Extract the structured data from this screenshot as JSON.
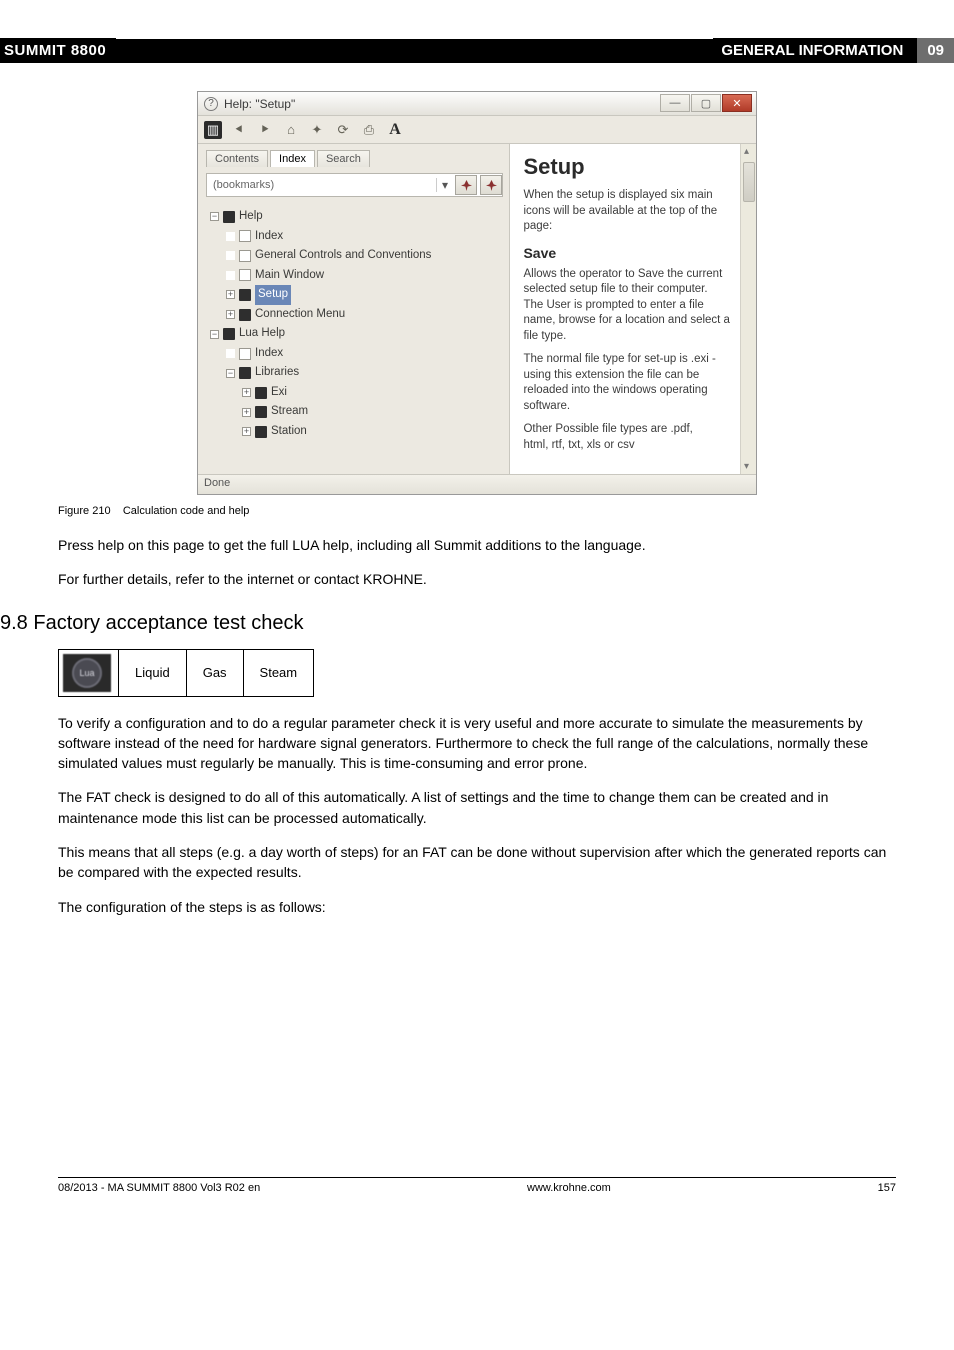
{
  "header": {
    "product": "SUMMIT 8800",
    "section": "GENERAL INFORMATION",
    "page_num": "09"
  },
  "help_window": {
    "title": "Help: \"Setup\"",
    "toolbar_a": "A",
    "tabs": [
      "Contents",
      "Index",
      "Search"
    ],
    "bookmarks_placeholder": "(bookmarks)",
    "tree": {
      "help": "Help",
      "index": "Index",
      "gcc": "General Controls and Conventions",
      "main_window": "Main Window",
      "setup": "Setup",
      "connection_menu": "Connection Menu",
      "lua_help": "Lua Help",
      "lua_index": "Index",
      "libraries": "Libraries",
      "exi": "Exi",
      "stream": "Stream",
      "station": "Station"
    },
    "content": {
      "h1": "Setup",
      "p1": "When the setup is displayed six main icons will be available at the top of the page:",
      "h2": "Save",
      "p2": "Allows the operator to Save the current selected setup file to their computer. The User is prompted to enter a file name, browse for a location and select a file type.",
      "p3": "The normal file type for set-up is .exi - using this extension the file can be reloaded into the windows operating software.",
      "p4": "Other Possible file types are .pdf,",
      "p5": "html, rtf, txt, xls or csv"
    },
    "status": "Done"
  },
  "figure": {
    "num": "Figure 210",
    "caption": "Calculation code and help"
  },
  "paragraphs": {
    "p_help": "Press help on this page to get the full LUA help, including all Summit additions to the language.",
    "p_details": "For further details, refer to the internet or contact KROHNE."
  },
  "section": {
    "heading": "9.8 Factory acceptance test check",
    "lua": "Lua",
    "cols": [
      "Liquid",
      "Gas",
      "Steam"
    ],
    "p1": "To verify a configuration and to do a regular parameter check it is very useful and more accurate to simulate the measurements by software instead of the need for hardware signal generators. Furthermore to check the full range of the calculations, normally these simulated values must regularly be manually. This is time-consuming and error prone.",
    "p2": "The FAT check is designed to do all of this automatically. A list of settings and the time to change them can be created and in maintenance mode this list can be processed automatically.",
    "p3": "This means that all steps (e.g. a day worth of steps)  for an FAT can be done without supervision after which  the generated reports can be compared with the expected results.",
    "p4": "The configuration of the steps is as follows:"
  },
  "footer": {
    "left": "08/2013 - MA SUMMIT 8800 Vol3 R02 en",
    "center": "www.krohne.com",
    "right": "157"
  }
}
